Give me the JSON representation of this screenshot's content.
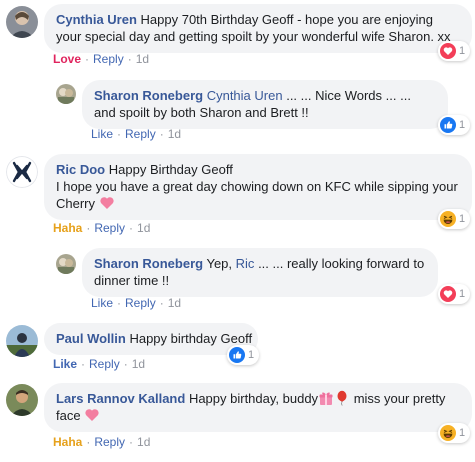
{
  "comments": [
    {
      "author": "Cynthia Uren",
      "text": "Happy 70th Birthday Geoff - hope you are enjoying your special day and getting spoilt by your wonderful wife Sharon. xx",
      "reaction_label": "Love",
      "reply_label": "Reply",
      "time": "1d",
      "reaction_count": "1",
      "reaction_icon": "heart-icon",
      "reply": {
        "author": "Sharon Roneberg",
        "mention": "Cynthia Uren",
        "text": "... ... Nice Words ... ... and spoilt by both Sharon and Brett !!",
        "reaction_label": "Like",
        "reply_label": "Reply",
        "time": "1d",
        "reaction_count": "1",
        "reaction_icon": "like-icon"
      }
    },
    {
      "author": "Ric Doo",
      "text_line1": "Happy Birthday Geoff",
      "text_line2": "I hope you have a great day chowing down on KFC while sipping your Cherry",
      "reaction_label": "Haha",
      "reply_label": "Reply",
      "time": "1d",
      "reaction_count": "1",
      "reaction_icon": "haha-icon",
      "reply": {
        "author": "Sharon Roneberg",
        "text_pre": "Yep,",
        "mention": "Ric",
        "text": "... ... really looking forward to dinner time !!",
        "reaction_label": "Like",
        "reply_label": "Reply",
        "time": "1d",
        "reaction_count": "1",
        "reaction_icon": "heart-icon"
      }
    },
    {
      "author": "Paul Wollin",
      "text": "Happy birthday Geoff",
      "reaction_label": "Like",
      "reply_label": "Reply",
      "time": "1d",
      "reaction_count": "1",
      "reaction_icon": "like-icon"
    },
    {
      "author": "Lars Rannov Kalland",
      "text_pre": "Happy birthday, buddy",
      "text_post": "miss your pretty",
      "text_line2": "face",
      "reaction_label": "Haha",
      "reply_label": "Reply",
      "time": "1d",
      "reaction_count": "1",
      "reaction_icon": "haha-icon"
    }
  ],
  "separator": "·",
  "colors": {
    "link": "#385898",
    "love": "#e0245e",
    "haha": "#e6a11b",
    "like": "#4267b2",
    "bubble": "#f2f3f5"
  }
}
